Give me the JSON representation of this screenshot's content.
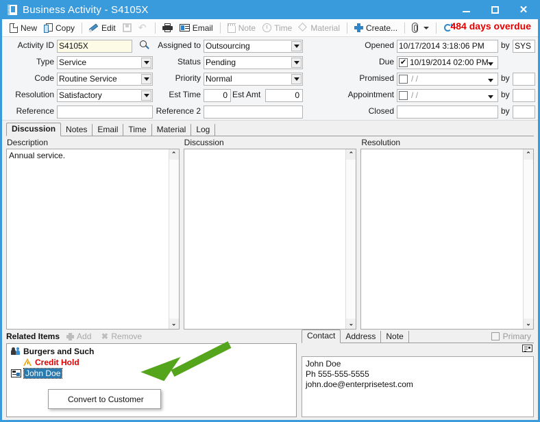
{
  "window": {
    "title": "Business Activity - S4105X",
    "icon": "notebook-icon",
    "minimize": "–",
    "maximize": "□",
    "close": "✕",
    "accent_color": "#3a9bdc"
  },
  "toolbar": {
    "items": [
      {
        "label": "New",
        "icon": "new-page-icon",
        "disabled": false
      },
      {
        "label": "Copy",
        "icon": "copy-icon",
        "disabled": false
      },
      {
        "label": "Edit",
        "icon": "pencil-icon",
        "disabled": false
      },
      {
        "label": "",
        "icon": "save-icon",
        "disabled": true
      },
      {
        "label": "",
        "icon": "undo-icon",
        "disabled": true
      },
      {
        "label": "",
        "icon": "printer-icon",
        "disabled": false
      },
      {
        "label": "Email",
        "icon": "email-icon",
        "disabled": false
      },
      {
        "label": "Note",
        "icon": "note-icon",
        "disabled": true
      },
      {
        "label": "Time",
        "icon": "clock-icon",
        "disabled": true
      },
      {
        "label": "Material",
        "icon": "tag-icon",
        "disabled": true
      },
      {
        "label": "Create...",
        "icon": "plus-icon",
        "disabled": false
      },
      {
        "label": "",
        "icon": "paperclip-icon",
        "disabled": false
      },
      {
        "label": "",
        "icon": "refresh-icon",
        "disabled": false
      }
    ],
    "overdue_notice": "484 days overdue",
    "overdue_color": "#e00000"
  },
  "form": {
    "left": [
      {
        "label": "Activity ID",
        "value": "S4105X",
        "type": "text-highlight"
      },
      {
        "label": "Type",
        "value": "Service",
        "type": "combo"
      },
      {
        "label": "Code",
        "value": "Routine Service",
        "type": "combo"
      },
      {
        "label": "Resolution",
        "value": "Satisfactory",
        "type": "combo"
      },
      {
        "label": "Reference",
        "value": "",
        "type": "text"
      }
    ],
    "middle": [
      {
        "label": "Assigned to",
        "value": "Outsourcing",
        "type": "combo"
      },
      {
        "label": "Status",
        "value": "Pending",
        "type": "combo"
      },
      {
        "label": "Priority",
        "value": "Normal",
        "type": "combo"
      },
      {
        "label": "Est Time",
        "value": "0",
        "type": "number"
      },
      {
        "label": "Est Amt",
        "value": "0",
        "type": "number"
      },
      {
        "label": "Reference 2",
        "value": "",
        "type": "text"
      }
    ],
    "right": [
      {
        "label": "Opened",
        "value": "10/17/2014 3:18:06 PM",
        "by_label": "by",
        "by_value": "SYS",
        "checkbox": null
      },
      {
        "label": "Due",
        "value": "10/19/2014 02:00 PM",
        "by_label": "",
        "by_value": "",
        "checkbox": true
      },
      {
        "label": "Promised",
        "value": "/  /",
        "by_label": "by",
        "by_value": "",
        "checkbox": false
      },
      {
        "label": "Appointment",
        "value": "/  /",
        "by_label": "by",
        "by_value": "",
        "checkbox": false
      },
      {
        "label": "Closed",
        "value": "",
        "by_label": "by",
        "by_value": "",
        "checkbox": null
      }
    ]
  },
  "tabs": {
    "items": [
      "Discussion",
      "Notes",
      "Email",
      "Time",
      "Material",
      "Log"
    ],
    "selected": "Discussion"
  },
  "panels": [
    {
      "caption": "Description",
      "text": "Annual service."
    },
    {
      "caption": "Discussion",
      "text": ""
    },
    {
      "caption": "Resolution",
      "text": ""
    }
  ],
  "related_items": {
    "title": "Related Items",
    "add_label": "Add",
    "remove_label": "Remove",
    "rows": [
      {
        "label": "Burgers and Such",
        "icon": "people-icon",
        "level": 1,
        "selected": false,
        "color": "#111111"
      },
      {
        "label": "Credit Hold",
        "icon": "warning-icon",
        "level": 2,
        "selected": false,
        "color": "#e00000"
      },
      {
        "label": "John Doe",
        "icon": "contact-card-icon",
        "level": 3,
        "selected": true,
        "color": "#ffffff"
      }
    ],
    "context_menu": {
      "items": [
        "Convert to Customer"
      ]
    },
    "annotation_arrow_color": "#55a51c"
  },
  "contact_panel": {
    "tabs": [
      "Contact",
      "Address",
      "Note"
    ],
    "selected": "Contact",
    "primary_label": "Primary",
    "primary_checked": false,
    "card_icon": "contact-card-icon",
    "body": "John Doe\nPh 555-555-5555\njohn.doe@enterprisetest.com"
  }
}
